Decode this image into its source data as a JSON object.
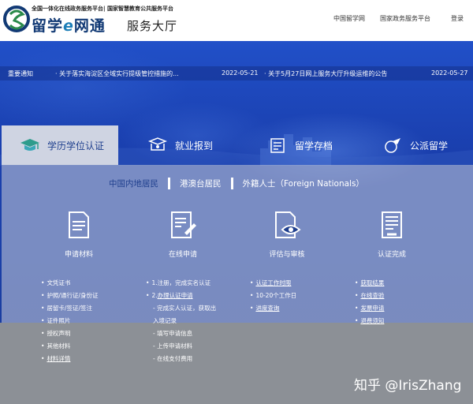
{
  "header": {
    "top_line": "全国一体化在线政务服务平台| 国家智慧教育公共服务平台",
    "title_pre": "留学",
    "title_e": "e",
    "title_post": "网通",
    "subtitle": "服务大厅",
    "nav": [
      "中国留学网",
      "国家政务服务平台",
      "登录"
    ]
  },
  "notice": {
    "label": "重要通知",
    "items": [
      {
        "text": "· 关于落实海淀区全域实行提级管控措施的...",
        "date": "2022-05-21"
      },
      {
        "text": "· 关于5月27日网上服务大厅升级运维的公告",
        "date": "2022-05-27"
      }
    ]
  },
  "tabs": [
    {
      "label": "学历学位认证",
      "icon": "graduation-cap-icon",
      "active": true
    },
    {
      "label": "就业报到",
      "icon": "id-card-icon"
    },
    {
      "label": "留学存档",
      "icon": "archive-folder-icon"
    },
    {
      "label": "公派留学",
      "icon": "airplane-globe-icon"
    }
  ],
  "subtabs": [
    "中国内地居民",
    "港澳台居民",
    "外籍人士（Foreign Nationals）"
  ],
  "steps": [
    {
      "label": "申请材料",
      "icon": "documents-icon"
    },
    {
      "label": "在线申请",
      "icon": "form-pen-icon"
    },
    {
      "label": "评估与审核",
      "icon": "review-eye-icon"
    },
    {
      "label": "认证完成",
      "icon": "certificate-icon"
    }
  ],
  "col1": [
    "文凭证书",
    "护照/通行证/身份证",
    "居留卡/签证/签注",
    "证件照片",
    "授权声明",
    "其他材料",
    "材料详情"
  ],
  "col2": [
    "1.注册，完成实名认证",
    "2.办理认证申请",
    "- 完成实人认证，获取出",
    "入境记录",
    "- 填写申请信息",
    "- 上传申请材料",
    "- 在线支付费用"
  ],
  "col3": [
    "认证工作时限",
    "10-20个工作日",
    "进度查询"
  ],
  "col4": [
    "获取结果",
    "在线查验",
    "发票申请",
    "退费须知"
  ],
  "watermark": "知乎 @IrisZhang",
  "colors": {
    "brand_blue": "#1f3f8e",
    "hero_blue": "#1a3fae",
    "panel_gray": "#8c9096"
  }
}
